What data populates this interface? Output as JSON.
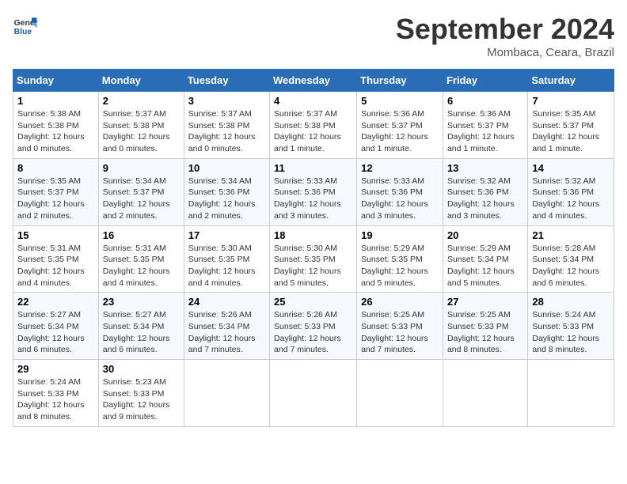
{
  "logo": {
    "line1": "General",
    "line2": "Blue"
  },
  "title": "September 2024",
  "location": "Mombaca, Ceara, Brazil",
  "headers": [
    "Sunday",
    "Monday",
    "Tuesday",
    "Wednesday",
    "Thursday",
    "Friday",
    "Saturday"
  ],
  "weeks": [
    [
      {
        "day": "1",
        "info": "Sunrise: 5:38 AM\nSunset: 5:38 PM\nDaylight: 12 hours\nand 0 minutes."
      },
      {
        "day": "2",
        "info": "Sunrise: 5:37 AM\nSunset: 5:38 PM\nDaylight: 12 hours\nand 0 minutes."
      },
      {
        "day": "3",
        "info": "Sunrise: 5:37 AM\nSunset: 5:38 PM\nDaylight: 12 hours\nand 0 minutes."
      },
      {
        "day": "4",
        "info": "Sunrise: 5:37 AM\nSunset: 5:38 PM\nDaylight: 12 hours\nand 1 minute."
      },
      {
        "day": "5",
        "info": "Sunrise: 5:36 AM\nSunset: 5:37 PM\nDaylight: 12 hours\nand 1 minute."
      },
      {
        "day": "6",
        "info": "Sunrise: 5:36 AM\nSunset: 5:37 PM\nDaylight: 12 hours\nand 1 minute."
      },
      {
        "day": "7",
        "info": "Sunrise: 5:35 AM\nSunset: 5:37 PM\nDaylight: 12 hours\nand 1 minute."
      }
    ],
    [
      {
        "day": "8",
        "info": "Sunrise: 5:35 AM\nSunset: 5:37 PM\nDaylight: 12 hours\nand 2 minutes."
      },
      {
        "day": "9",
        "info": "Sunrise: 5:34 AM\nSunset: 5:37 PM\nDaylight: 12 hours\nand 2 minutes."
      },
      {
        "day": "10",
        "info": "Sunrise: 5:34 AM\nSunset: 5:36 PM\nDaylight: 12 hours\nand 2 minutes."
      },
      {
        "day": "11",
        "info": "Sunrise: 5:33 AM\nSunset: 5:36 PM\nDaylight: 12 hours\nand 3 minutes."
      },
      {
        "day": "12",
        "info": "Sunrise: 5:33 AM\nSunset: 5:36 PM\nDaylight: 12 hours\nand 3 minutes."
      },
      {
        "day": "13",
        "info": "Sunrise: 5:32 AM\nSunset: 5:36 PM\nDaylight: 12 hours\nand 3 minutes."
      },
      {
        "day": "14",
        "info": "Sunrise: 5:32 AM\nSunset: 5:36 PM\nDaylight: 12 hours\nand 4 minutes."
      }
    ],
    [
      {
        "day": "15",
        "info": "Sunrise: 5:31 AM\nSunset: 5:35 PM\nDaylight: 12 hours\nand 4 minutes."
      },
      {
        "day": "16",
        "info": "Sunrise: 5:31 AM\nSunset: 5:35 PM\nDaylight: 12 hours\nand 4 minutes."
      },
      {
        "day": "17",
        "info": "Sunrise: 5:30 AM\nSunset: 5:35 PM\nDaylight: 12 hours\nand 4 minutes."
      },
      {
        "day": "18",
        "info": "Sunrise: 5:30 AM\nSunset: 5:35 PM\nDaylight: 12 hours\nand 5 minutes."
      },
      {
        "day": "19",
        "info": "Sunrise: 5:29 AM\nSunset: 5:35 PM\nDaylight: 12 hours\nand 5 minutes."
      },
      {
        "day": "20",
        "info": "Sunrise: 5:29 AM\nSunset: 5:34 PM\nDaylight: 12 hours\nand 5 minutes."
      },
      {
        "day": "21",
        "info": "Sunrise: 5:28 AM\nSunset: 5:34 PM\nDaylight: 12 hours\nand 6 minutes."
      }
    ],
    [
      {
        "day": "22",
        "info": "Sunrise: 5:27 AM\nSunset: 5:34 PM\nDaylight: 12 hours\nand 6 minutes."
      },
      {
        "day": "23",
        "info": "Sunrise: 5:27 AM\nSunset: 5:34 PM\nDaylight: 12 hours\nand 6 minutes."
      },
      {
        "day": "24",
        "info": "Sunrise: 5:26 AM\nSunset: 5:34 PM\nDaylight: 12 hours\nand 7 minutes."
      },
      {
        "day": "25",
        "info": "Sunrise: 5:26 AM\nSunset: 5:33 PM\nDaylight: 12 hours\nand 7 minutes."
      },
      {
        "day": "26",
        "info": "Sunrise: 5:25 AM\nSunset: 5:33 PM\nDaylight: 12 hours\nand 7 minutes."
      },
      {
        "day": "27",
        "info": "Sunrise: 5:25 AM\nSunset: 5:33 PM\nDaylight: 12 hours\nand 8 minutes."
      },
      {
        "day": "28",
        "info": "Sunrise: 5:24 AM\nSunset: 5:33 PM\nDaylight: 12 hours\nand 8 minutes."
      }
    ],
    [
      {
        "day": "29",
        "info": "Sunrise: 5:24 AM\nSunset: 5:33 PM\nDaylight: 12 hours\nand 8 minutes."
      },
      {
        "day": "30",
        "info": "Sunrise: 5:23 AM\nSunset: 5:33 PM\nDaylight: 12 hours\nand 9 minutes."
      },
      {
        "day": "",
        "info": ""
      },
      {
        "day": "",
        "info": ""
      },
      {
        "day": "",
        "info": ""
      },
      {
        "day": "",
        "info": ""
      },
      {
        "day": "",
        "info": ""
      }
    ]
  ]
}
